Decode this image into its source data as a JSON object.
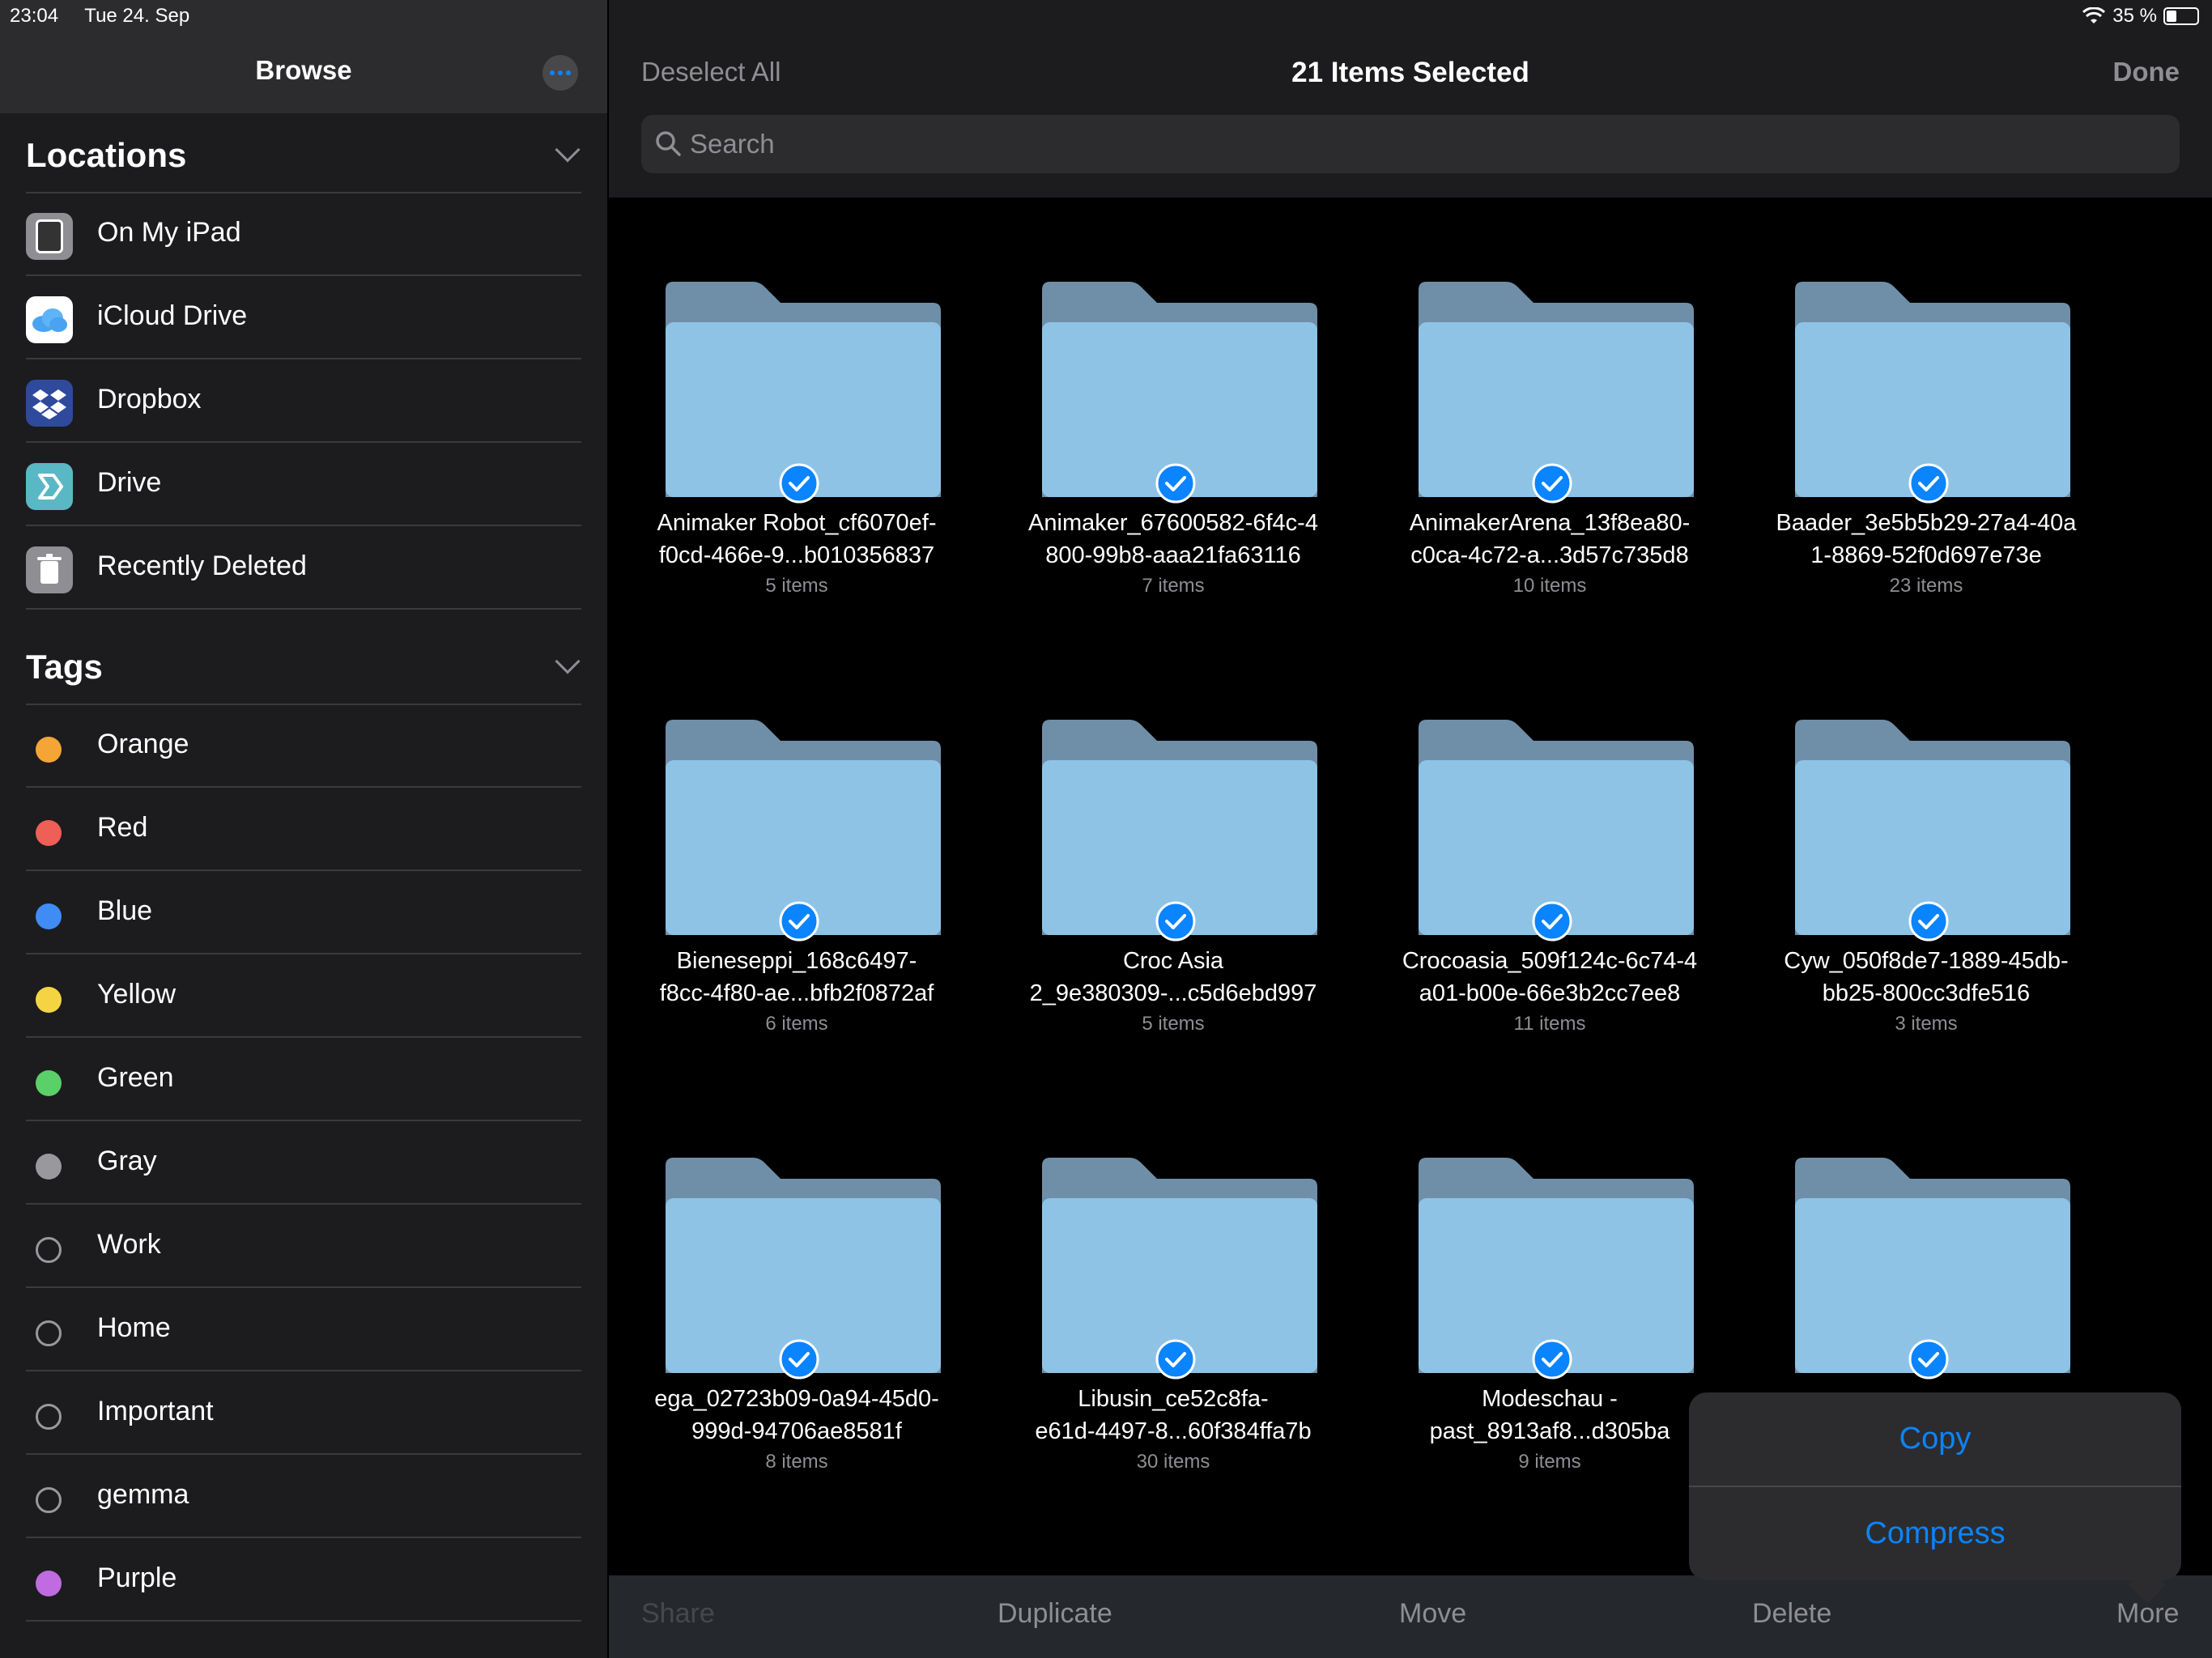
{
  "status": {
    "time": "23:04",
    "date": "Tue 24. Sep",
    "battery": "35 %"
  },
  "sidebar": {
    "title": "Browse",
    "locations_header": "Locations",
    "locations": [
      {
        "label": "On My iPad",
        "icon": "ipad-icon"
      },
      {
        "label": "iCloud Drive",
        "icon": "icloud-icon"
      },
      {
        "label": "Dropbox",
        "icon": "dropbox-icon"
      },
      {
        "label": "Drive",
        "icon": "drive-icon"
      },
      {
        "label": "Recently Deleted",
        "icon": "trash-icon"
      }
    ],
    "tags_header": "Tags",
    "tags": [
      {
        "label": "Orange",
        "color": "#f4a536"
      },
      {
        "label": "Red",
        "color": "#ee5f57"
      },
      {
        "label": "Blue",
        "color": "#3f8cf5"
      },
      {
        "label": "Yellow",
        "color": "#f5d444"
      },
      {
        "label": "Green",
        "color": "#5ad068"
      },
      {
        "label": "Gray",
        "color": "#98989d"
      },
      {
        "label": "Work",
        "color": ""
      },
      {
        "label": "Home",
        "color": ""
      },
      {
        "label": "Important",
        "color": ""
      },
      {
        "label": "gemma",
        "color": ""
      },
      {
        "label": "Purple",
        "color": "#c06be0"
      }
    ]
  },
  "header": {
    "deselect_label": "Deselect All",
    "title": "21 Items Selected",
    "done_label": "Done",
    "search_placeholder": "Search"
  },
  "folders": [
    {
      "name_line1": "Animaker Robot_cf6070ef-",
      "name_line2": "f0cd-466e-9...b010356837",
      "count": "5 items"
    },
    {
      "name_line1": "Animaker_67600582-6f4c-4",
      "name_line2": "800-99b8-aaa21fa63116",
      "count": "7 items"
    },
    {
      "name_line1": "AnimakerArena_13f8ea80-",
      "name_line2": "c0ca-4c72-a...3d57c735d8",
      "count": "10 items"
    },
    {
      "name_line1": "Baader_3e5b5b29-27a4-40a",
      "name_line2": "1-8869-52f0d697e73e",
      "count": "23 items"
    },
    {
      "name_line1": "Bieneseppi_168c6497-",
      "name_line2": "f8cc-4f80-ae...bfb2f0872af",
      "count": "6 items"
    },
    {
      "name_line1": "Croc Asia",
      "name_line2": "2_9e380309-...c5d6ebd997",
      "count": "5 items"
    },
    {
      "name_line1": "Crocoasia_509f124c-6c74-4",
      "name_line2": "a01-b00e-66e3b2cc7ee8",
      "count": "11 items"
    },
    {
      "name_line1": "Cyw_050f8de7-1889-45db-",
      "name_line2": "bb25-800cc3dfe516",
      "count": "3 items"
    },
    {
      "name_line1": "ega_02723b09-0a94-45d0-",
      "name_line2": "999d-94706ae8581f",
      "count": "8 items"
    },
    {
      "name_line1": "Libusin_ce52c8fa-",
      "name_line2": "e61d-4497-8...60f384ffa7b",
      "count": "30 items"
    },
    {
      "name_line1": "Modeschau -",
      "name_line2": "past_8913af8...d305ba",
      "count": "9 items"
    },
    {
      "name_line1": "",
      "name_line2": "",
      "count": ""
    }
  ],
  "menu": {
    "copy_label": "Copy",
    "compress_label": "Compress"
  },
  "toolbar": {
    "share_label": "Share",
    "duplicate_label": "Duplicate",
    "move_label": "Move",
    "delete_label": "Delete",
    "more_label": "More"
  },
  "colors": {
    "accent": "#0a84ff",
    "folder_top": "#6f8fa8",
    "folder_front": "#8ec3e6"
  }
}
